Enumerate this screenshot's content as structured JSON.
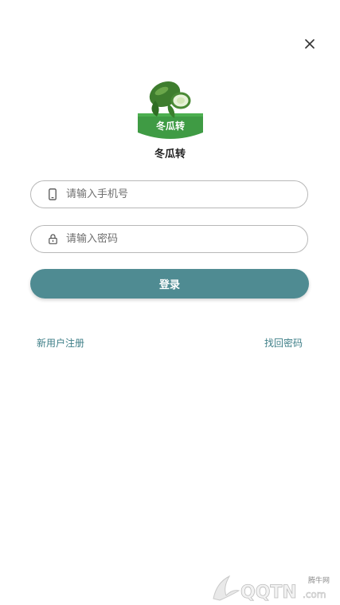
{
  "colors": {
    "primary": "#4f8b92",
    "link": "#3f7f88",
    "border": "#b8b8b8",
    "logo_green": "#3f9b44"
  },
  "close": {
    "icon": "close-icon"
  },
  "logo": {
    "badge_text": "冬瓜转",
    "app_name": "冬瓜转"
  },
  "login_form": {
    "phone": {
      "placeholder": "请输入手机号",
      "value": "",
      "icon": "phone-icon"
    },
    "password": {
      "placeholder": "请输入密码",
      "value": "",
      "icon": "lock-icon"
    },
    "submit_label": "登录"
  },
  "links": {
    "register": "新用户注册",
    "forgot_password": "找回密码"
  },
  "watermark": {
    "site_name": "腾牛网",
    "brand": "QQTN",
    "domain": ".com"
  }
}
